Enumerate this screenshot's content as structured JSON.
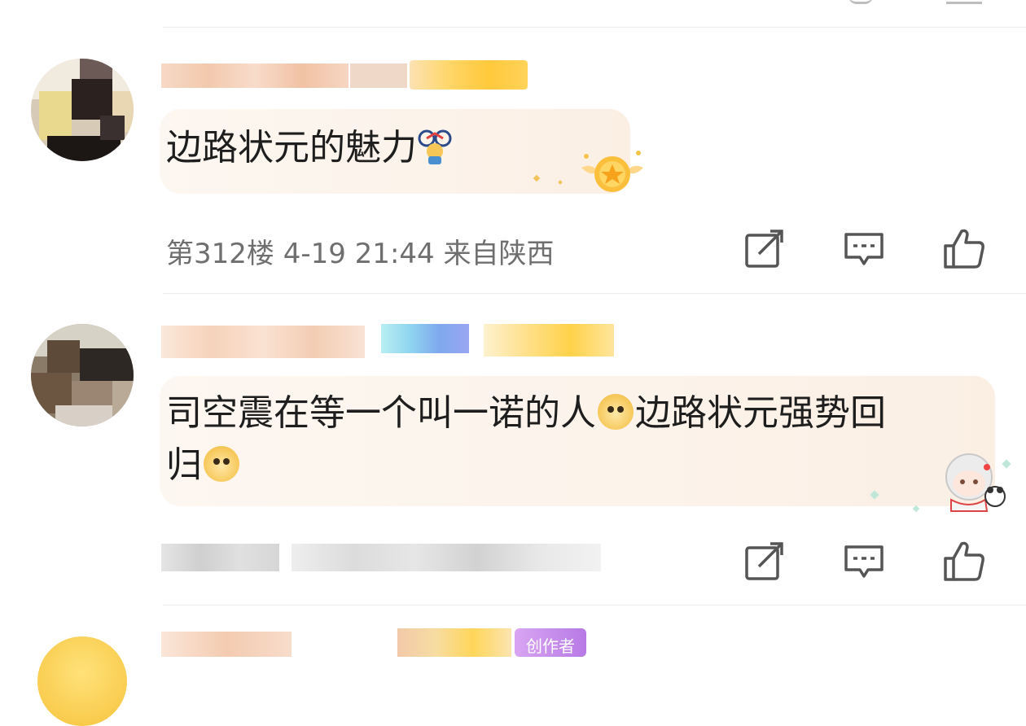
{
  "comments": [
    {
      "floor_meta": "第312楼 4-19 21:44 来自陕西",
      "text": "边路状元的魅力"
    },
    {
      "text_line1": "司空震在等一个叫一诺的人",
      "text_line1b": "边路状元强势回",
      "text_line2": "归"
    }
  ],
  "icons": {
    "edit": "edit-icon",
    "reply": "comment-icon",
    "like": "thumbs-up-icon",
    "emoji_bike": "bike-emoji-icon",
    "emoji_doge": "doge-emoji-icon"
  },
  "partial_badge": "创作者"
}
